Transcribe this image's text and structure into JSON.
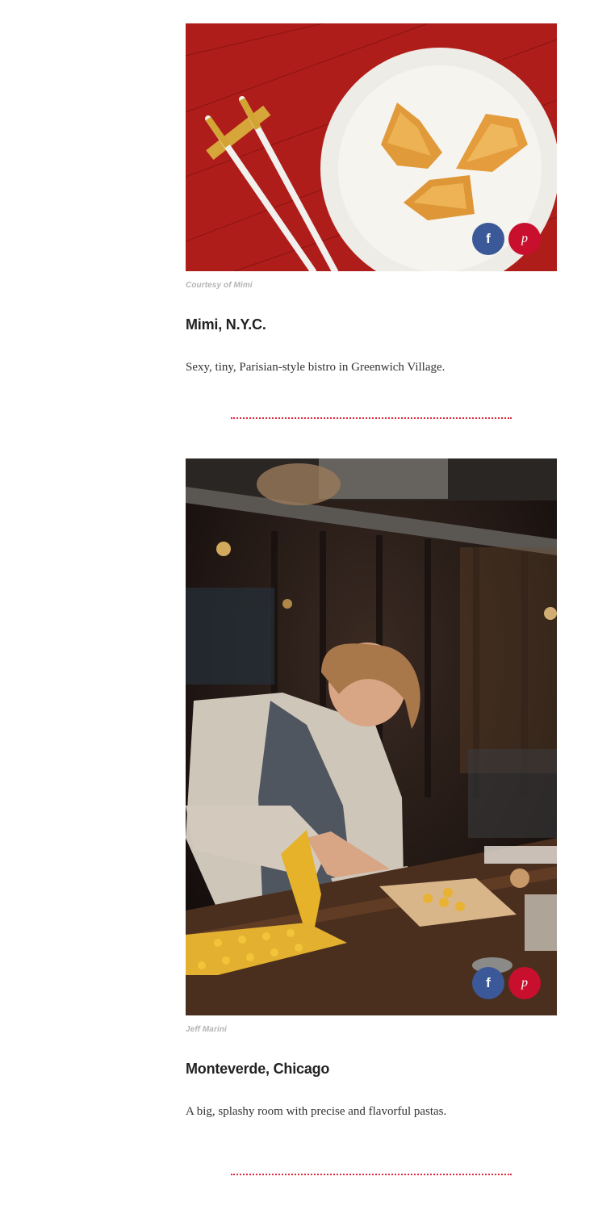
{
  "entries": [
    {
      "credit": "Courtesy of Mimi",
      "name": "Mimi, N.Y.C.",
      "description": "Sexy, tiny, Parisian-style bistro in Greenwich Village.",
      "share": {
        "facebook_icon": "f",
        "pinterest_icon": "p"
      }
    },
    {
      "credit": "Jeff Marini",
      "name": "Monteverde, Chicago",
      "description": "A big, splashy room with precise and flavorful pastas.",
      "share": {
        "facebook_icon": "f",
        "pinterest_icon": "p"
      }
    }
  ],
  "colors": {
    "facebook": "#3b5998",
    "pinterest": "#c8102e",
    "divider": "#e0283a",
    "credit": "#b4b4b4"
  }
}
